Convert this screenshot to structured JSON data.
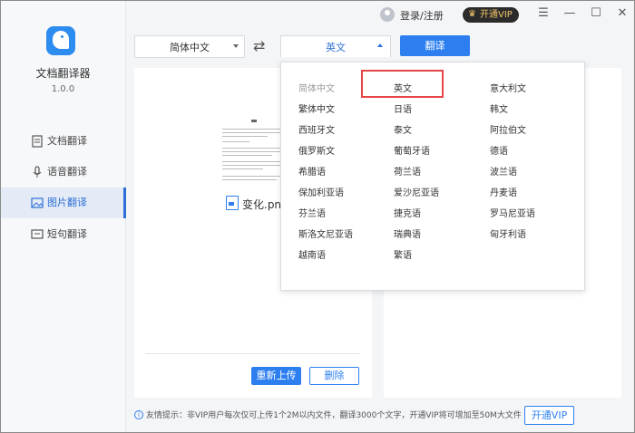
{
  "app": {
    "name": "文档翻译器",
    "version": "1.0.0"
  },
  "header": {
    "login_label": "登录/注册",
    "vip_label": "开通VIP",
    "crown_icon": "crown-icon"
  },
  "window_controls": {
    "menu": "☰",
    "minimize": "—",
    "maximize": "☐",
    "close": "✕"
  },
  "sidebar": {
    "items": [
      {
        "label": "文档翻译",
        "icon": "document-icon"
      },
      {
        "label": "语音翻译",
        "icon": "microphone-icon"
      },
      {
        "label": "图片翻译",
        "icon": "image-icon",
        "active": true
      },
      {
        "label": "短句翻译",
        "icon": "chat-icon"
      }
    ]
  },
  "toolbar": {
    "source_lang": "简体中文",
    "swap_icon": "⇄",
    "target_lang": "英文",
    "translate_label": "翻译"
  },
  "upload": {
    "file_name": "变化.png",
    "reupload_label": "重新上传",
    "delete_label": "删除"
  },
  "footer": {
    "tip_icon": "i",
    "tip": "友情提示：非VIP用户每次仅可上传1个2M以内文件，翻译3000个文字，开通VIP将可增加至50M大文件",
    "vip_button": "开通VIP"
  },
  "dropdown": {
    "languages": [
      [
        "简体中文",
        "英文",
        "意大利文"
      ],
      [
        "繁体中文",
        "日语",
        "韩文"
      ],
      [
        "西班牙文",
        "泰文",
        "阿拉伯文"
      ],
      [
        "俄罗斯文",
        "葡萄牙语",
        "德语"
      ],
      [
        "希腊语",
        "荷兰语",
        "波兰语"
      ],
      [
        "保加利亚语",
        "爱沙尼亚语",
        "丹麦语"
      ],
      [
        "芬兰语",
        "捷克语",
        "罗马尼亚语"
      ],
      [
        "斯洛文尼亚语",
        "瑞典语",
        "匈牙利语"
      ],
      [
        "越南语",
        "繁语",
        ""
      ]
    ],
    "disabled": "简体中文",
    "selected": "英文"
  },
  "colors": {
    "accent": "#2d7ff0",
    "highlight": "#e64545"
  }
}
